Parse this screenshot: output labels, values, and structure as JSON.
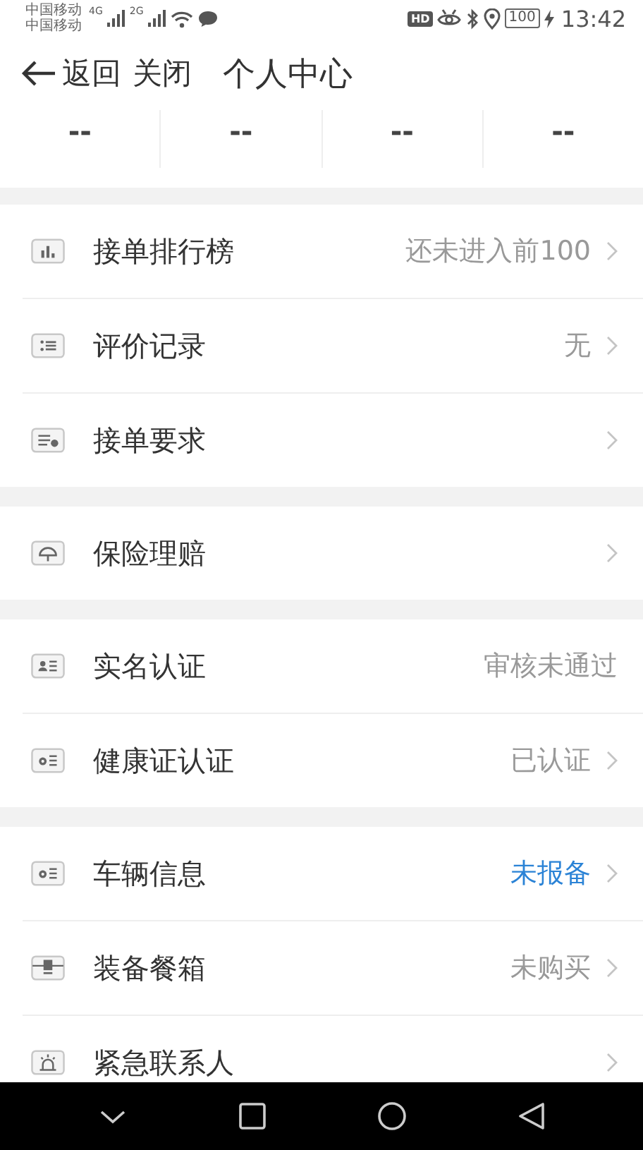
{
  "status_bar": {
    "carriers": [
      "中国移动",
      "中国移动"
    ],
    "networks": [
      "4G",
      "2G"
    ],
    "hd": "HD",
    "battery": "100",
    "charging": true,
    "time": "13:42"
  },
  "header": {
    "back": "返回",
    "close": "关闭",
    "title": "个人中心"
  },
  "stats": [
    "--",
    "--",
    "--",
    "--"
  ],
  "sections": [
    {
      "items": [
        {
          "kind": "bars",
          "label": "接单排行榜",
          "value": "还未进入前100",
          "highlight": false,
          "chevron": true
        },
        {
          "kind": "list",
          "label": "评价记录",
          "value": "无",
          "highlight": false,
          "chevron": true
        },
        {
          "kind": "list-check",
          "label": "接单要求",
          "chevron": true
        }
      ]
    },
    {
      "items": [
        {
          "kind": "umbrella",
          "label": "保险理赔",
          "chevron": true
        }
      ]
    },
    {
      "items": [
        {
          "kind": "person-card",
          "label": "实名认证",
          "value": "审核未通过",
          "highlight": false,
          "chevron": false
        },
        {
          "kind": "badge-card",
          "label": "健康证认证",
          "value": "已认证",
          "highlight": false,
          "chevron": true
        }
      ]
    },
    {
      "items": [
        {
          "kind": "badge-card",
          "label": "车辆信息",
          "value": "未报备",
          "highlight": true,
          "chevron": true
        },
        {
          "kind": "box",
          "label": "装备餐箱",
          "value": "未购买",
          "highlight": false,
          "chevron": true
        },
        {
          "kind": "siren",
          "label": "紧急联系人",
          "chevron": true
        }
      ]
    }
  ]
}
